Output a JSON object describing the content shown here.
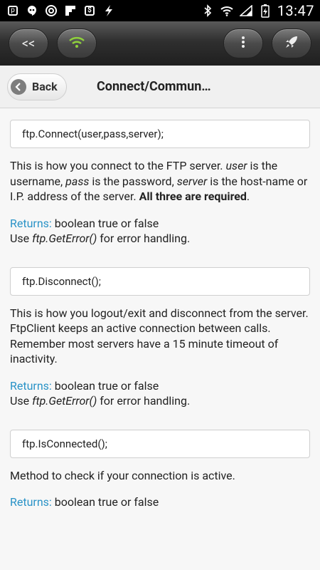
{
  "status_bar": {
    "time": "13:47",
    "left_icons": [
      "search-icon",
      "hangouts-icon",
      "sync-icon",
      "flipboard-icon",
      "dollar-app-icon",
      "flash-icon"
    ],
    "right_icons": [
      "bluetooth-icon",
      "wifi-icon",
      "signal-icon",
      "battery-charging-icon"
    ]
  },
  "toolbar": {
    "back_label": "<<",
    "wifi_icon": "wifi-icon",
    "menu_icon": "more-vertical-icon",
    "rocket_icon": "rocket-icon",
    "wifi_color": "#8fd13c"
  },
  "header": {
    "back_label": "Back",
    "title": "Connect/Commun…"
  },
  "sections": [
    {
      "code": "ftp.Connect(user,pass,server);",
      "desc_parts": [
        {
          "t": "This is how you connect to the FTP server. "
        },
        {
          "t": "user",
          "i": true
        },
        {
          "t": " is the username, "
        },
        {
          "t": "pass",
          "i": true
        },
        {
          "t": " is the password, "
        },
        {
          "t": "server",
          "i": true
        },
        {
          "t": " is the host-name or I.P. address of the server. "
        },
        {
          "t": "All three are required",
          "b": true
        },
        {
          "t": "."
        }
      ],
      "returns_label": "Returns:",
      "returns_value": " boolean true or false",
      "use_prefix": "Use ",
      "use_method": "ftp.GetError()",
      "use_suffix": " for error handling."
    },
    {
      "code": "ftp.Disconnect();",
      "desc_parts": [
        {
          "t": "This is how you logout/exit and disconnect from the server. FtpClient keeps an active connection between calls. Remember most servers have a 15 minute timeout of inactivity."
        }
      ],
      "returns_label": "Returns:",
      "returns_value": " boolean true or false",
      "use_prefix": "Use ",
      "use_method": "ftp.GetError()",
      "use_suffix": " for error handling."
    },
    {
      "code": "ftp.IsConnected();",
      "desc_parts": [
        {
          "t": "Method to check if your connection is active."
        }
      ],
      "returns_label": "Returns:",
      "returns_value": " boolean true or false"
    }
  ]
}
